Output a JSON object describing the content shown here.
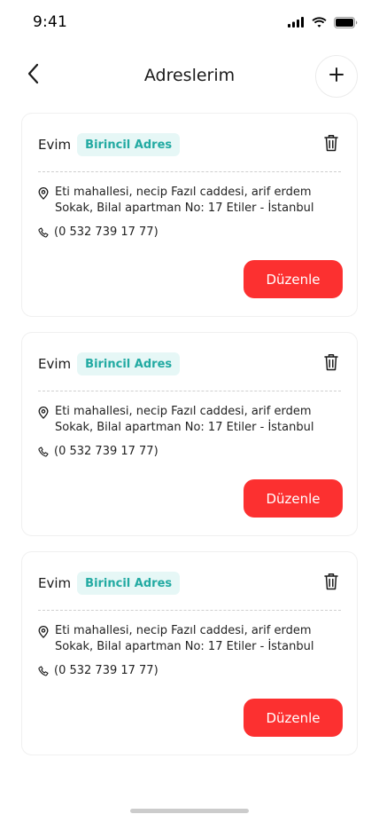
{
  "status_bar": {
    "time": "9:41",
    "icons": [
      "signal-icon",
      "wifi-icon",
      "battery-icon"
    ]
  },
  "header": {
    "title": "Adreslerim",
    "back_icon": "chevron-left-icon",
    "add_icon": "plus-icon"
  },
  "addresses": [
    {
      "name": "Evim",
      "badge": "Birincil Adres",
      "address": "Eti mahallesi, necip Fazıl caddesi, arif erdem Sokak, Bilal apartman No: 17 Etiler - İstanbul",
      "phone": "(0 532 739 17 77)",
      "edit_label": "Düzenle"
    },
    {
      "name": "Evim",
      "badge": "Birincil Adres",
      "address": "Eti mahallesi, necip Fazıl caddesi, arif erdem Sokak, Bilal apartman No: 17 Etiler - İstanbul",
      "phone": "(0 532 739 17 77)",
      "edit_label": "Düzenle"
    },
    {
      "name": "Evim",
      "badge": "Birincil Adres",
      "address": "Eti mahallesi, necip Fazıl caddesi, arif erdem Sokak, Bilal apartman No: 17 Etiler - İstanbul",
      "phone": "(0 532 739 17 77)",
      "edit_label": "Düzenle"
    }
  ],
  "colors": {
    "accent": "#fc3030",
    "badge_bg": "#e6f7f6",
    "badge_text": "#22aaa2"
  }
}
